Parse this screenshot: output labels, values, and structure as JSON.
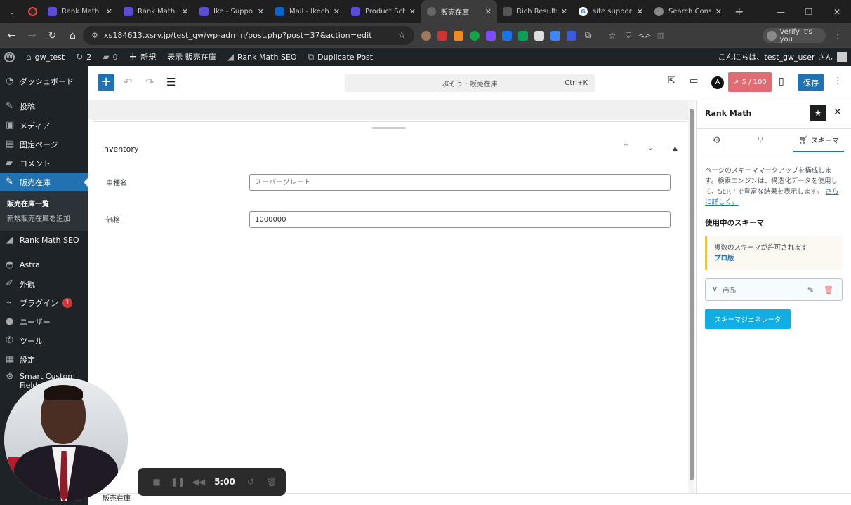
{
  "browser": {
    "tabs": [
      {
        "label": "Rank Math",
        "favicon_color": "#5b4ed1"
      },
      {
        "label": "Rank Math",
        "favicon_color": "#5b4ed1"
      },
      {
        "label": "Ike - Suppor",
        "favicon_color": "#5b4ed1"
      },
      {
        "label": "Mail - Ikech",
        "favicon_color": "#0a64c8"
      },
      {
        "label": "Product Sch",
        "favicon_color": "#5b4ed1"
      },
      {
        "label": "販売在庫",
        "favicon_color": "#666666",
        "active": true
      },
      {
        "label": "Rich Results",
        "favicon_color": "#555555"
      },
      {
        "label": "site suppor",
        "favicon_color": "#ffffff"
      },
      {
        "label": "Search Cons",
        "favicon_color": "#888888"
      }
    ],
    "url": "xs184613.xsrv.jp/test_gw/wp-admin/post.php?post=37&action=edit",
    "profile_label": "Verify it's you"
  },
  "adminbar": {
    "site_name": "gw_test",
    "updates_count": "2",
    "comments_count": "0",
    "new_label": "新規",
    "view_label": "表示 販売在庫",
    "rankmath_label": "Rank Math SEO",
    "duplicate_label": "Duplicate Post",
    "greeting": "こんにちは、test_gw_user さん"
  },
  "sidebar": {
    "items": [
      {
        "label": "ダッシュボード",
        "icon": "dashboard-icon"
      },
      {
        "label": "投稿",
        "icon": "pin-icon"
      },
      {
        "label": "メディア",
        "icon": "media-icon"
      },
      {
        "label": "固定ページ",
        "icon": "page-icon"
      },
      {
        "label": "コメント",
        "icon": "comment-icon"
      },
      {
        "label": "販売在庫",
        "icon": "pin-icon",
        "current": true
      }
    ],
    "submenu": [
      {
        "label": "販売在庫一覧",
        "current": true
      },
      {
        "label": "新規販売在庫を追加"
      }
    ],
    "items2": [
      {
        "label": "Rank Math SEO",
        "icon": "chart-icon"
      },
      {
        "label": "Astra",
        "icon": "astra-icon"
      },
      {
        "label": "外観",
        "icon": "brush-icon"
      },
      {
        "label": "プラグイン",
        "icon": "plugin-icon",
        "badge": "1"
      },
      {
        "label": "ユーザー",
        "icon": "user-icon"
      },
      {
        "label": "ツール",
        "icon": "wrench-icon"
      },
      {
        "label": "設定",
        "icon": "settings-icon"
      },
      {
        "label": "Smart Custom Fields",
        "icon": "gear-icon"
      }
    ]
  },
  "editor": {
    "command_label": "ぶそう · 販売在庫",
    "command_shortcut": "Ctrl+K",
    "seo_score": "5 / 100",
    "save_label": "保存",
    "metabox_title": "inventory",
    "fields": [
      {
        "label": "車種名",
        "value": "",
        "placeholder": "スーパーグレート"
      },
      {
        "label": "価格",
        "value": "1000000",
        "placeholder": ""
      }
    ],
    "breadcrumb": "販売在庫"
  },
  "rankmath": {
    "title": "Rank Math",
    "schema_tab_label": "スキーマ",
    "description": "ページのスキーママークアップを構成します。検索エンジンは、構造化データを使用して、SERP で豊富な結果を表示します。",
    "learn_more": "さらに詳しく。",
    "in_use_heading": "使用中のスキーマ",
    "notice_text": "複数のスキーマが許可されます",
    "notice_link": "プロ版",
    "schema_item": "商品",
    "generator_label": "スキーマジェネレータ"
  },
  "recorder": {
    "time": "5:00"
  }
}
